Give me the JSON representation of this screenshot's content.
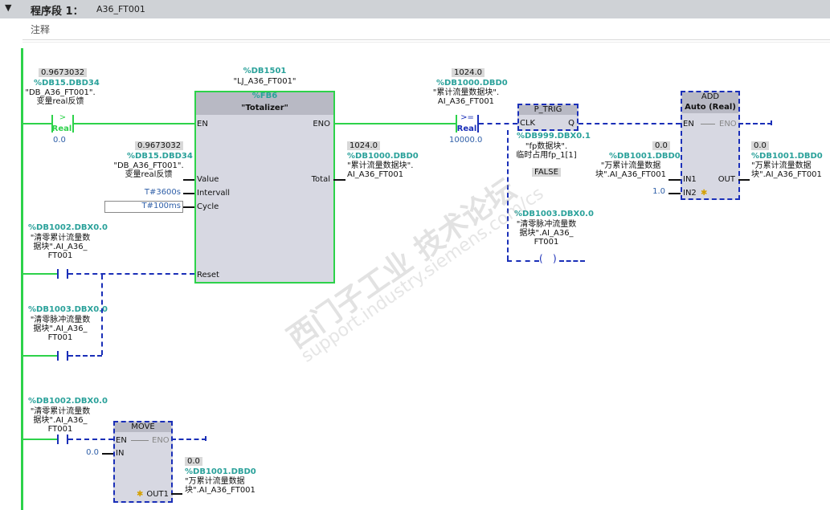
{
  "header": {
    "arrow": "▼",
    "title": "程序段 1：",
    "name": "A36_FT001"
  },
  "comment": "注释",
  "c1": {
    "value": "0.9673032",
    "tag": "%DB15.DBD34",
    "name1": "\"DB_A36_FT001\".",
    "name2": "变量real反馈",
    "op": ">",
    "type": "Real",
    "ref": "0.0"
  },
  "fb": {
    "instance_tag": "%DB1501",
    "instance_name": "\"LJ_A36_FT001\"",
    "fb_tag": "%FB6",
    "fb_name": "\"Totalizer\"",
    "pins": {
      "en": "EN",
      "eno": "ENO",
      "value": "Value",
      "interval": "Intervall",
      "cycle": "Cycle",
      "total": "Total",
      "reset": "Reset"
    },
    "value_in": {
      "value": "0.9673032",
      "tag": "%DB15.DBD34",
      "name1": "\"DB_A36_FT001\".",
      "name2": "变量real反馈"
    },
    "interval_in": "T#3600s",
    "cycle_in": "T#100ms",
    "total_out": {
      "value": "1024.0",
      "tag": "%DB1000.DBD0",
      "name1": "\"累计流量数据块\".",
      "name2": "AI_A36_FT001"
    }
  },
  "reset1": {
    "tag": "%DB1002.DBX0.0",
    "name1": "\"清零累计流量数",
    "name2": "据块\".AI_A36_",
    "name3": "FT001"
  },
  "reset2": {
    "tag": "%DB1003.DBX0.0",
    "name1": "\"清零脉冲流量数",
    "name2": "据块\".AI_A36_",
    "name3": "FT001"
  },
  "c2": {
    "value": "1024.0",
    "tag": "%DB1000.DBD0",
    "name1": "\"累计流量数据块\".",
    "name2": "AI_A36_FT001",
    "op": ">=",
    "type": "Real",
    "ref": "10000.0"
  },
  "ptrig": {
    "title": "P_TRIG",
    "clk": "CLK",
    "q": "Q",
    "tag": "%DB999.DBX0.1",
    "name1": "\"fp数据块\".",
    "name2": "临时占用fp_1[1]",
    "state": "FALSE"
  },
  "coil": {
    "tag": "%DB1003.DBX0.0",
    "name1": "\"清零脉冲流量数",
    "name2": "据块\".AI_A36_",
    "name3": "FT001"
  },
  "add": {
    "title": "ADD",
    "type": "Auto (Real)",
    "en": "EN",
    "eno": "ENO",
    "in1": "IN1",
    "in2": "IN2",
    "out": "OUT",
    "in1_src": {
      "value": "0.0",
      "tag": "%DB1001.DBD0",
      "name1": "\"万累计流量数据",
      "name2": "块\".AI_A36_FT001"
    },
    "in2_val": "1.0",
    "out_dst": {
      "value": "0.0",
      "tag": "%DB1001.DBD0",
      "name1": "\"万累计流量数据",
      "name2": "块\".AI_A36_FT001"
    }
  },
  "row3": {
    "tag": "%DB1002.DBX0.0",
    "name1": "\"清零累计流量数",
    "name2": "据块\".AI_A36_",
    "name3": "FT001"
  },
  "move": {
    "title": "MOVE",
    "en": "EN",
    "eno": "ENO",
    "in": "IN",
    "out1": "OUT1",
    "in_val": "0.0",
    "out_dst": {
      "value": "0.0",
      "tag": "%DB1001.DBD0",
      "name1": "\"万累计流量数据",
      "name2": "块\".AI_A36_FT001"
    }
  },
  "watermark": {
    "cn": "西门子工业 技术论坛",
    "url": "support.industry.siemens.com/cs"
  },
  "colors": {
    "power": "#2dd24a",
    "no_power": "#1a2fb8",
    "tag": "#2aa19a",
    "box": "#d7d8e2"
  }
}
